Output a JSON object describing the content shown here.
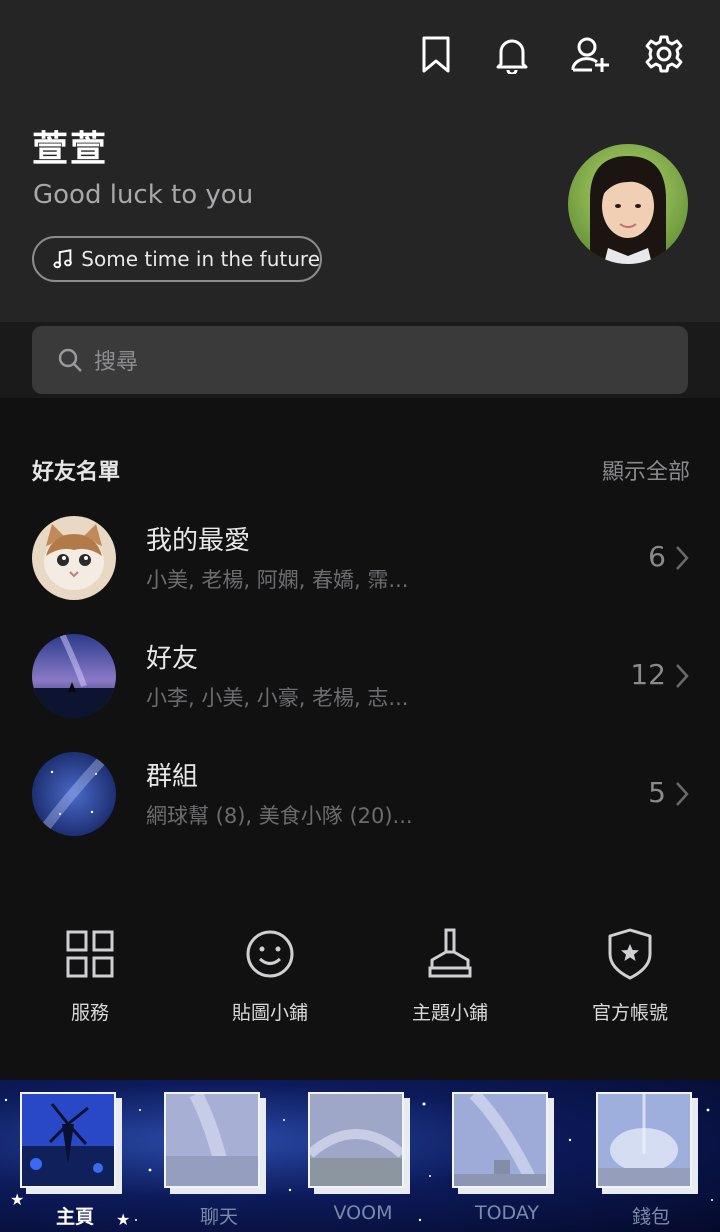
{
  "profile": {
    "name": "萱萱",
    "status": "Good luck to you",
    "music": "Some time in the future"
  },
  "header_icons": [
    "bookmark-icon",
    "bell-icon",
    "add-friend-icon",
    "gear-icon"
  ],
  "search": {
    "placeholder": "搜尋"
  },
  "friends_section": {
    "title": "好友名單",
    "show_all": "顯示全部",
    "groups": [
      {
        "title": "我的最愛",
        "members": "小美, 老楊, 阿嫻, 春嬌, 霈...",
        "count": "6"
      },
      {
        "title": "好友",
        "members": "小李, 小美, 小豪, 老楊, 志...",
        "count": "12"
      },
      {
        "title": "群組",
        "members": "網球幫 (8), 美食小隊 (20)...",
        "count": "5"
      }
    ]
  },
  "services": [
    {
      "label": "服務",
      "icon": "grid-icon"
    },
    {
      "label": "貼圖小鋪",
      "icon": "smiley-icon"
    },
    {
      "label": "主題小鋪",
      "icon": "brush-icon"
    },
    {
      "label": "官方帳號",
      "icon": "shield-star-icon"
    }
  ],
  "tabs": [
    {
      "label": "主頁",
      "active": true
    },
    {
      "label": "聊天",
      "active": false
    },
    {
      "label": "VOOM",
      "active": false
    },
    {
      "label": "TODAY",
      "active": false
    },
    {
      "label": "錢包",
      "active": false
    }
  ],
  "colors": {
    "header_bg": "#252526",
    "page_bg": "#111112",
    "search_bg": "#3a3a3b",
    "tab_bg": "#0c1a5a"
  }
}
